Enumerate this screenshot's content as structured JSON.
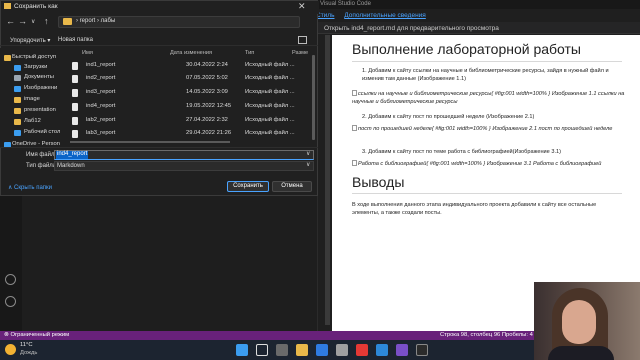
{
  "vscode": {
    "window_title": "Visual Studio Code",
    "menu_links": [
      "Стиль",
      "Дополнительные сведения"
    ],
    "tab_label": "Открыть ind4_report.md для предварительного просмотра"
  },
  "preview": {
    "heading1": "Выполнение лабораторной работы",
    "step1": "1. Добавим к сайту ссылки на научные и библиометрические ресурсы, зайдя в нужный файл и изменив там данные (Изображение 1.1)",
    "img1_alt": "ссылки на научные и библиометрические ресурсы{ #fig:001 width=100% } Изображение 1.1 ссылки на научные и библиометрические ресурсы",
    "step2": "2. Добавим к сайту пост по прошедшей неделе (Изображение 2.1)",
    "img2_alt": "пост по прошедшей неделе{ #fig:001 width=100% } Изображение 2.1 пост по прошедшей неделе",
    "step3": "3. Добавим к сайту пост по теме работа с библиографией(Изображение 3.1)",
    "img3_alt": "Работа с библиографией{ #fig:001 width=100% } Изображение 3.1 Работа с библиографией",
    "heading2": "Выводы",
    "conclusion": "В ходе выполнения данного этапа индивидуального проекта добавили к сайту все остальные элементы, а также создали посты."
  },
  "statusbar": {
    "left": "⊗ Ограниченный режим",
    "right": "Строка 98, столбец 96   Пробелы: 4"
  },
  "taskbar": {
    "temp": "11°C",
    "weather": "Дождь"
  },
  "dialog": {
    "title": "Сохранить как",
    "path_segments": "›  report  ›  лабы",
    "organize": "Упорядочить ▾",
    "new_folder": "Новая папка",
    "columns": {
      "name": "Имя",
      "modified": "Дата изменения",
      "type": "Тип",
      "size": "Разме"
    },
    "nav_items": [
      {
        "label": "Быстрый доступ",
        "color": "#e9b84a"
      },
      {
        "label": "Загрузки",
        "color": "#3b9df0"
      },
      {
        "label": "Документы",
        "color": "#9aa6b2"
      },
      {
        "label": "Изображени",
        "color": "#3b9df0"
      },
      {
        "label": "image",
        "color": "#e9b84a"
      },
      {
        "label": "presentation",
        "color": "#e9b84a"
      },
      {
        "label": "Лаб12",
        "color": "#e9b84a"
      },
      {
        "label": "Рабочий стол",
        "color": "#3b9df0"
      },
      {
        "label": "OneDrive - Person",
        "color": "#3b9df0"
      }
    ],
    "files": [
      {
        "name": "ind1_report",
        "modified": "30.04.2022 2:24",
        "type": "Исходный файл ..."
      },
      {
        "name": "ind2_report",
        "modified": "07.05.2022 5:02",
        "type": "Исходный файл ..."
      },
      {
        "name": "ind3_report",
        "modified": "14.05.2022 3:09",
        "type": "Исходный файл ..."
      },
      {
        "name": "ind4_report",
        "modified": "19.05.2022 12:45",
        "type": "Исходный файл ..."
      },
      {
        "name": "lab2_report",
        "modified": "27.04.2022 2:32",
        "type": "Исходный файл ..."
      },
      {
        "name": "lab3_report",
        "modified": "29.04.2022 21:26",
        "type": "Исходный файл ..."
      }
    ],
    "filename_label": "Имя файла:",
    "filename_value": "ind4_report",
    "filetype_label": "Тип файла:",
    "filetype_value": "Markdown",
    "hide_folders": "∧ Скрыть папки",
    "save_button": "Сохранить",
    "cancel_button": "Отмена"
  }
}
